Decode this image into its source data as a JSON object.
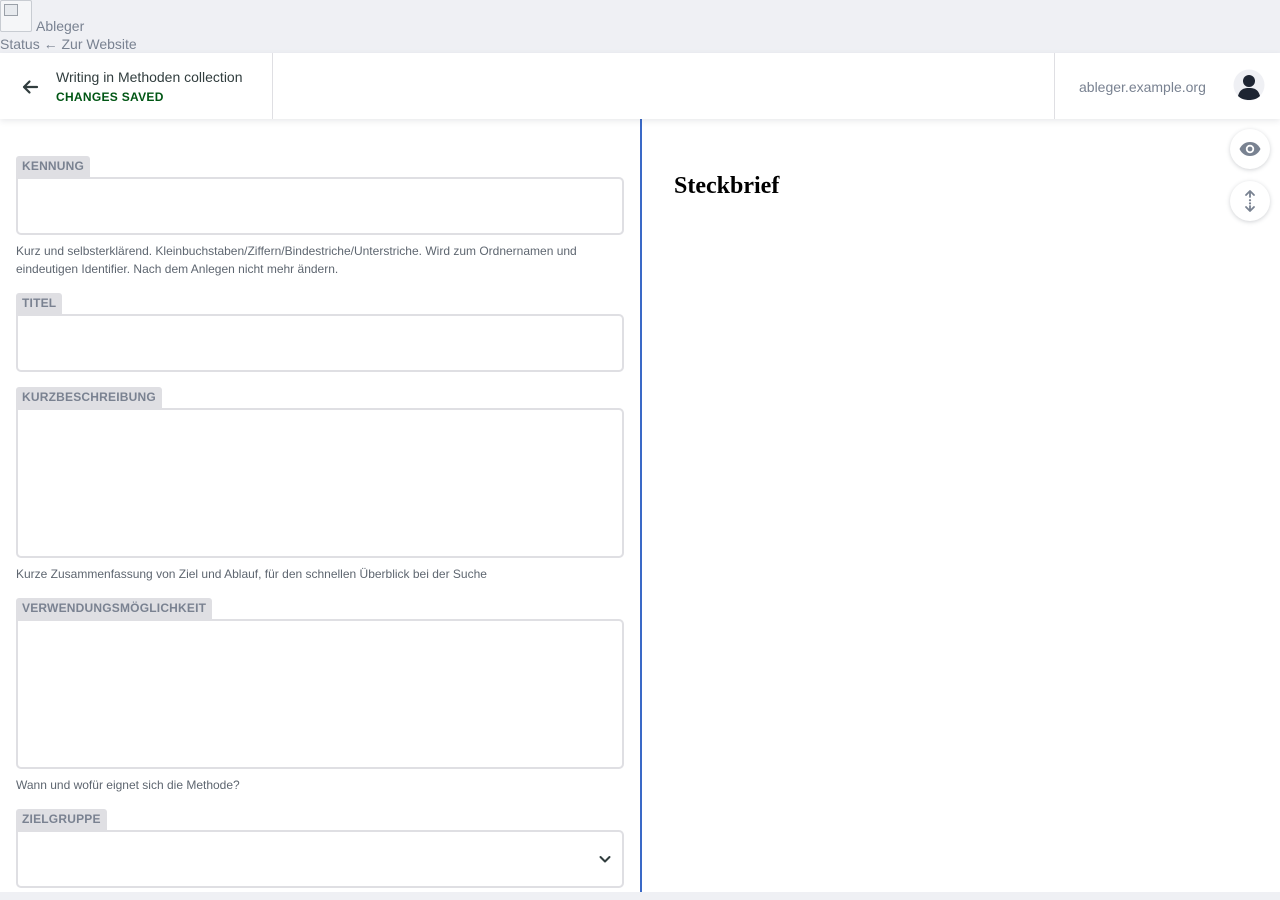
{
  "app": {
    "brand": "Ableger",
    "links": [
      "Status",
      "← Zur Website"
    ]
  },
  "toolbar": {
    "entry_title": "Writing in Methoden collection",
    "save_status": "CHANGES SAVED",
    "site_url": "ableger.example.org"
  },
  "form": {
    "kennung": {
      "label": "KENNUNG",
      "value": "",
      "hint": "Kurz und selbsterklärend. Kleinbuchstaben/Ziffern/Bindestriche/Unterstriche. Wird zum Ordnernamen und eindeutigen Identifier. Nach dem Anlegen nicht mehr ändern."
    },
    "titel": {
      "label": "TITEL",
      "value": ""
    },
    "kurzbeschreibung": {
      "label": "KURZBESCHREIBUNG",
      "value": "",
      "hint": "Kurze Zusammenfassung von Ziel und Ablauf, für den schnellen Überblick bei der Suche"
    },
    "verwendung": {
      "label": "VERWENDUNGSMÖGLICHKEIT",
      "value": "",
      "hint": "Wann und wofür eignet sich die Methode?"
    },
    "zielgruppe": {
      "label": "ZIELGRUPPE",
      "selected": ""
    }
  },
  "preview": {
    "heading": "Steckbrief"
  },
  "colors": {
    "divider": "#3a69c7",
    "saved": "#005614",
    "label_bg": "#dfdfe3"
  },
  "icons": [
    "back-arrow-icon",
    "user-avatar-icon",
    "eye-icon",
    "sync-scroll-icon",
    "chevron-down-icon"
  ]
}
